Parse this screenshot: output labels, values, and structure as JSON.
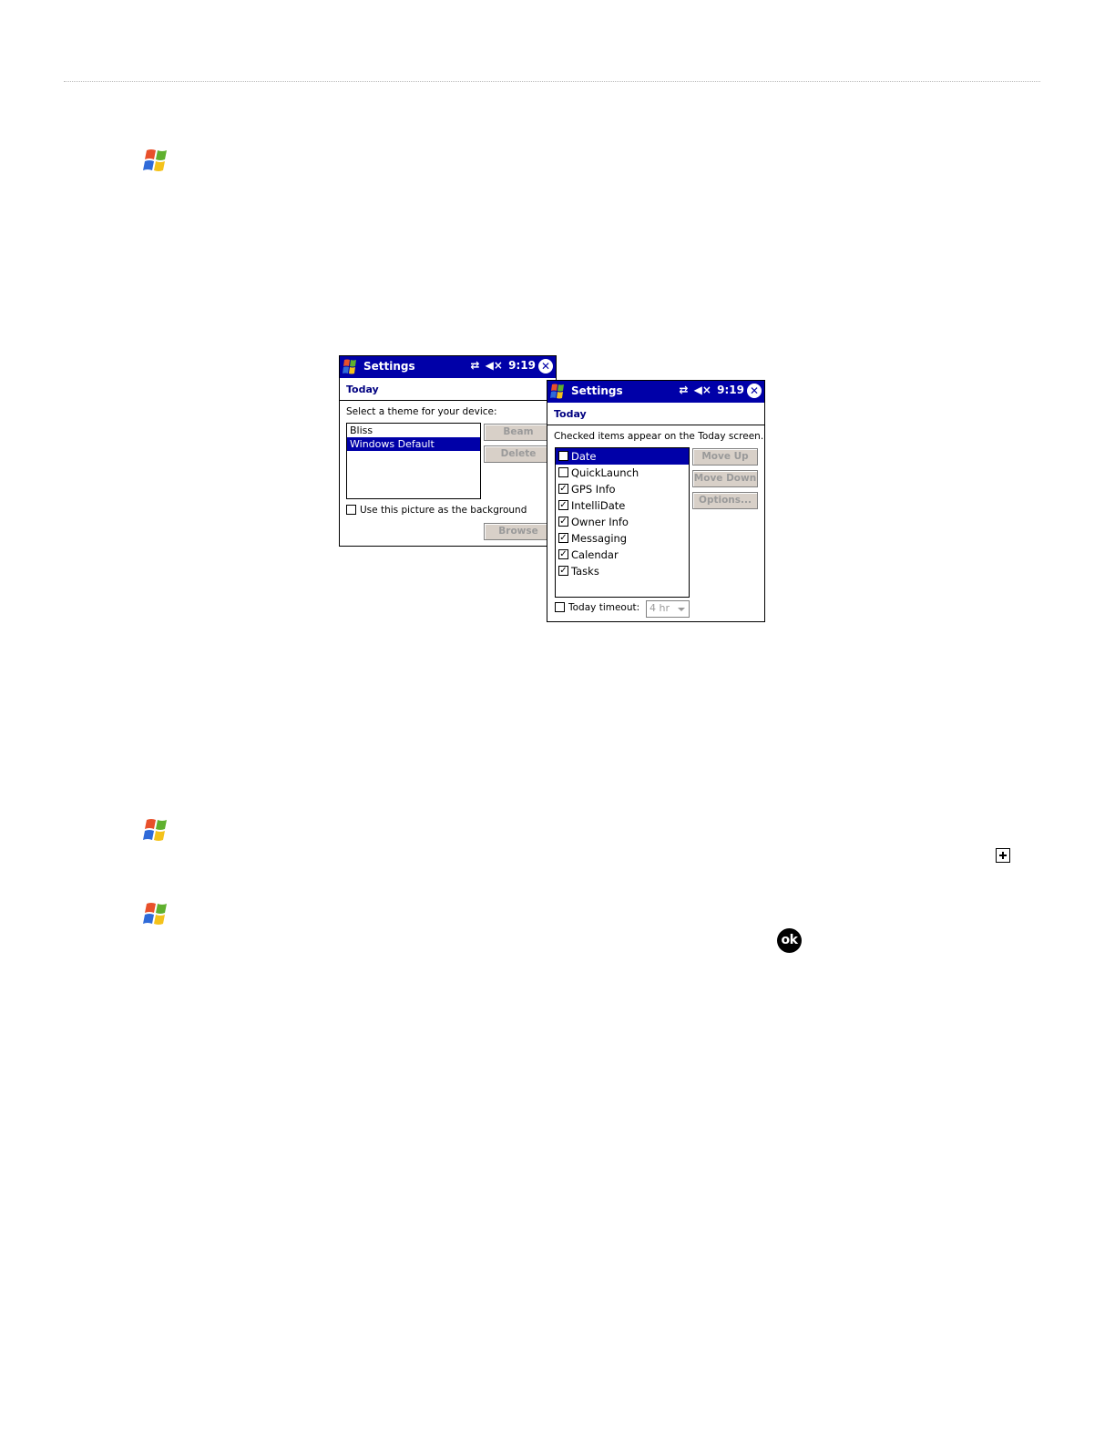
{
  "screen1": {
    "title": "Settings",
    "status_time": "9:19",
    "section": "Today",
    "prompt": "Select a theme for your device:",
    "themes": [
      {
        "label": "Bliss",
        "selected": false
      },
      {
        "label": "Windows Default",
        "selected": true
      }
    ],
    "buttons": {
      "beam": "Beam",
      "delete": "Delete",
      "browse": "Browse"
    },
    "background_checkbox": {
      "label": "Use this picture as the background",
      "checked": false
    }
  },
  "screen2": {
    "title": "Settings",
    "status_time": "9:19",
    "section": "Today",
    "prompt": "Checked items appear on the Today screen.",
    "items": [
      {
        "label": "Date",
        "checked": false,
        "selected": true
      },
      {
        "label": "QuickLaunch",
        "checked": false,
        "selected": false
      },
      {
        "label": "GPS Info",
        "checked": true,
        "selected": false
      },
      {
        "label": "IntelliDate",
        "checked": true,
        "selected": false
      },
      {
        "label": "Owner Info",
        "checked": true,
        "selected": false
      },
      {
        "label": "Messaging",
        "checked": true,
        "selected": false
      },
      {
        "label": "Calendar",
        "checked": true,
        "selected": false
      },
      {
        "label": "Tasks",
        "checked": true,
        "selected": false
      }
    ],
    "buttons": {
      "move_up": "Move Up",
      "move_down": "Move Down",
      "options": "Options..."
    },
    "timeout": {
      "label": "Today timeout:",
      "checked": false,
      "value": "4 hr"
    }
  },
  "icons": {
    "start": "windows-flag-icon",
    "expand": "plus-box-icon",
    "ok": "ok-button-icon"
  },
  "colors": {
    "titlebar": "#0000a8",
    "selection": "#0000a8",
    "button_face": "#d8d0c8",
    "disabled_text": "#9a9a9a"
  },
  "ok_label": "ok"
}
